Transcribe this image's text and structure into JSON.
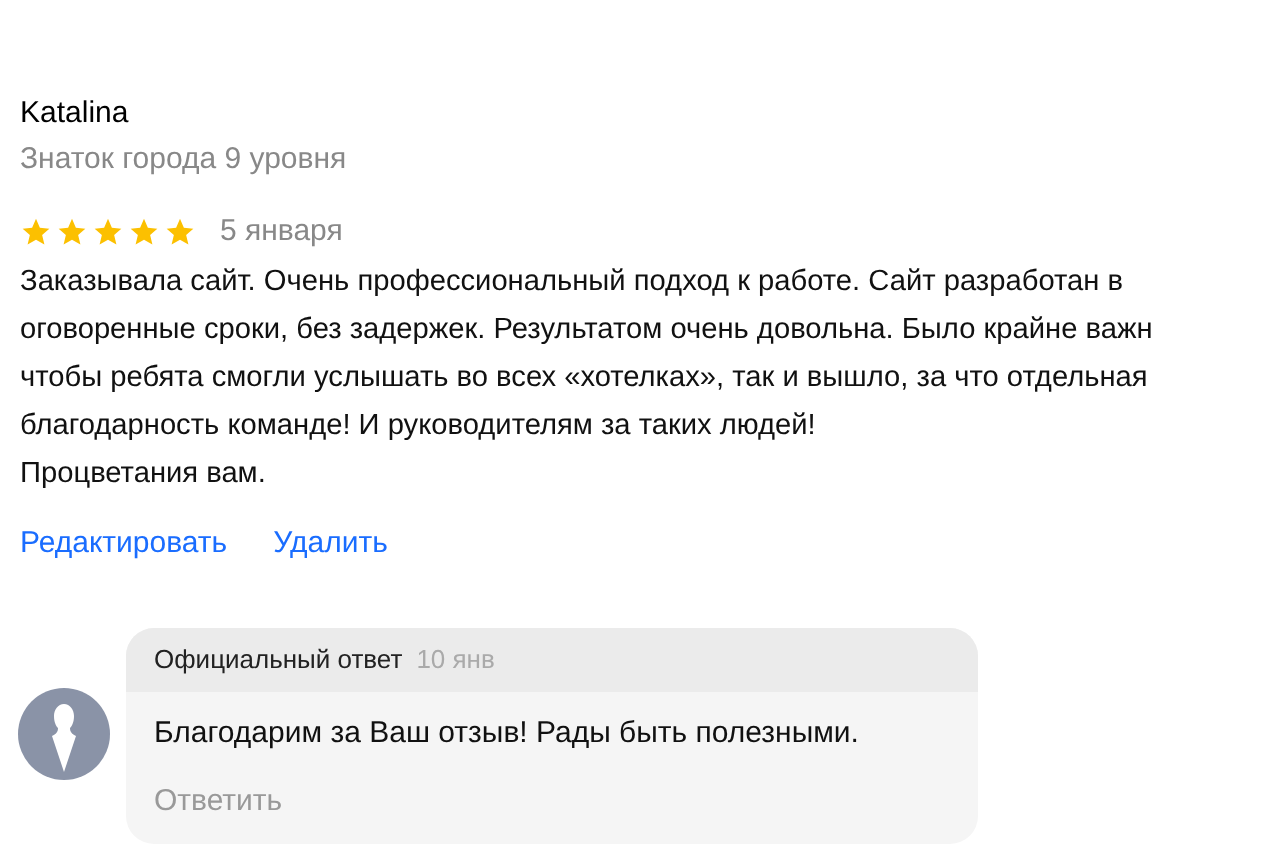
{
  "review": {
    "author": "Katalina",
    "author_level": "Знаток города 9 уровня",
    "stars": 5,
    "date": "5 января",
    "text_lines": [
      "Заказывала сайт. Очень профессиональный подход к работе. Сайт разработан в",
      "оговоренные сроки, без задержек. Результатом очень довольна. Было крайне важн",
      "чтобы ребята смогли услышать во всех «хотелках», так и вышло, за что отдельная",
      "благодарность команде! И руководителям за таких людей!",
      "Процветания вам."
    ],
    "actions": [
      "Редактировать",
      "Удалить"
    ]
  },
  "reply": {
    "label": "Официальный ответ",
    "date": "10 янв",
    "text": "Благодарим за Ваш отзыв! Рады быть полезными.",
    "action": "Ответить"
  }
}
